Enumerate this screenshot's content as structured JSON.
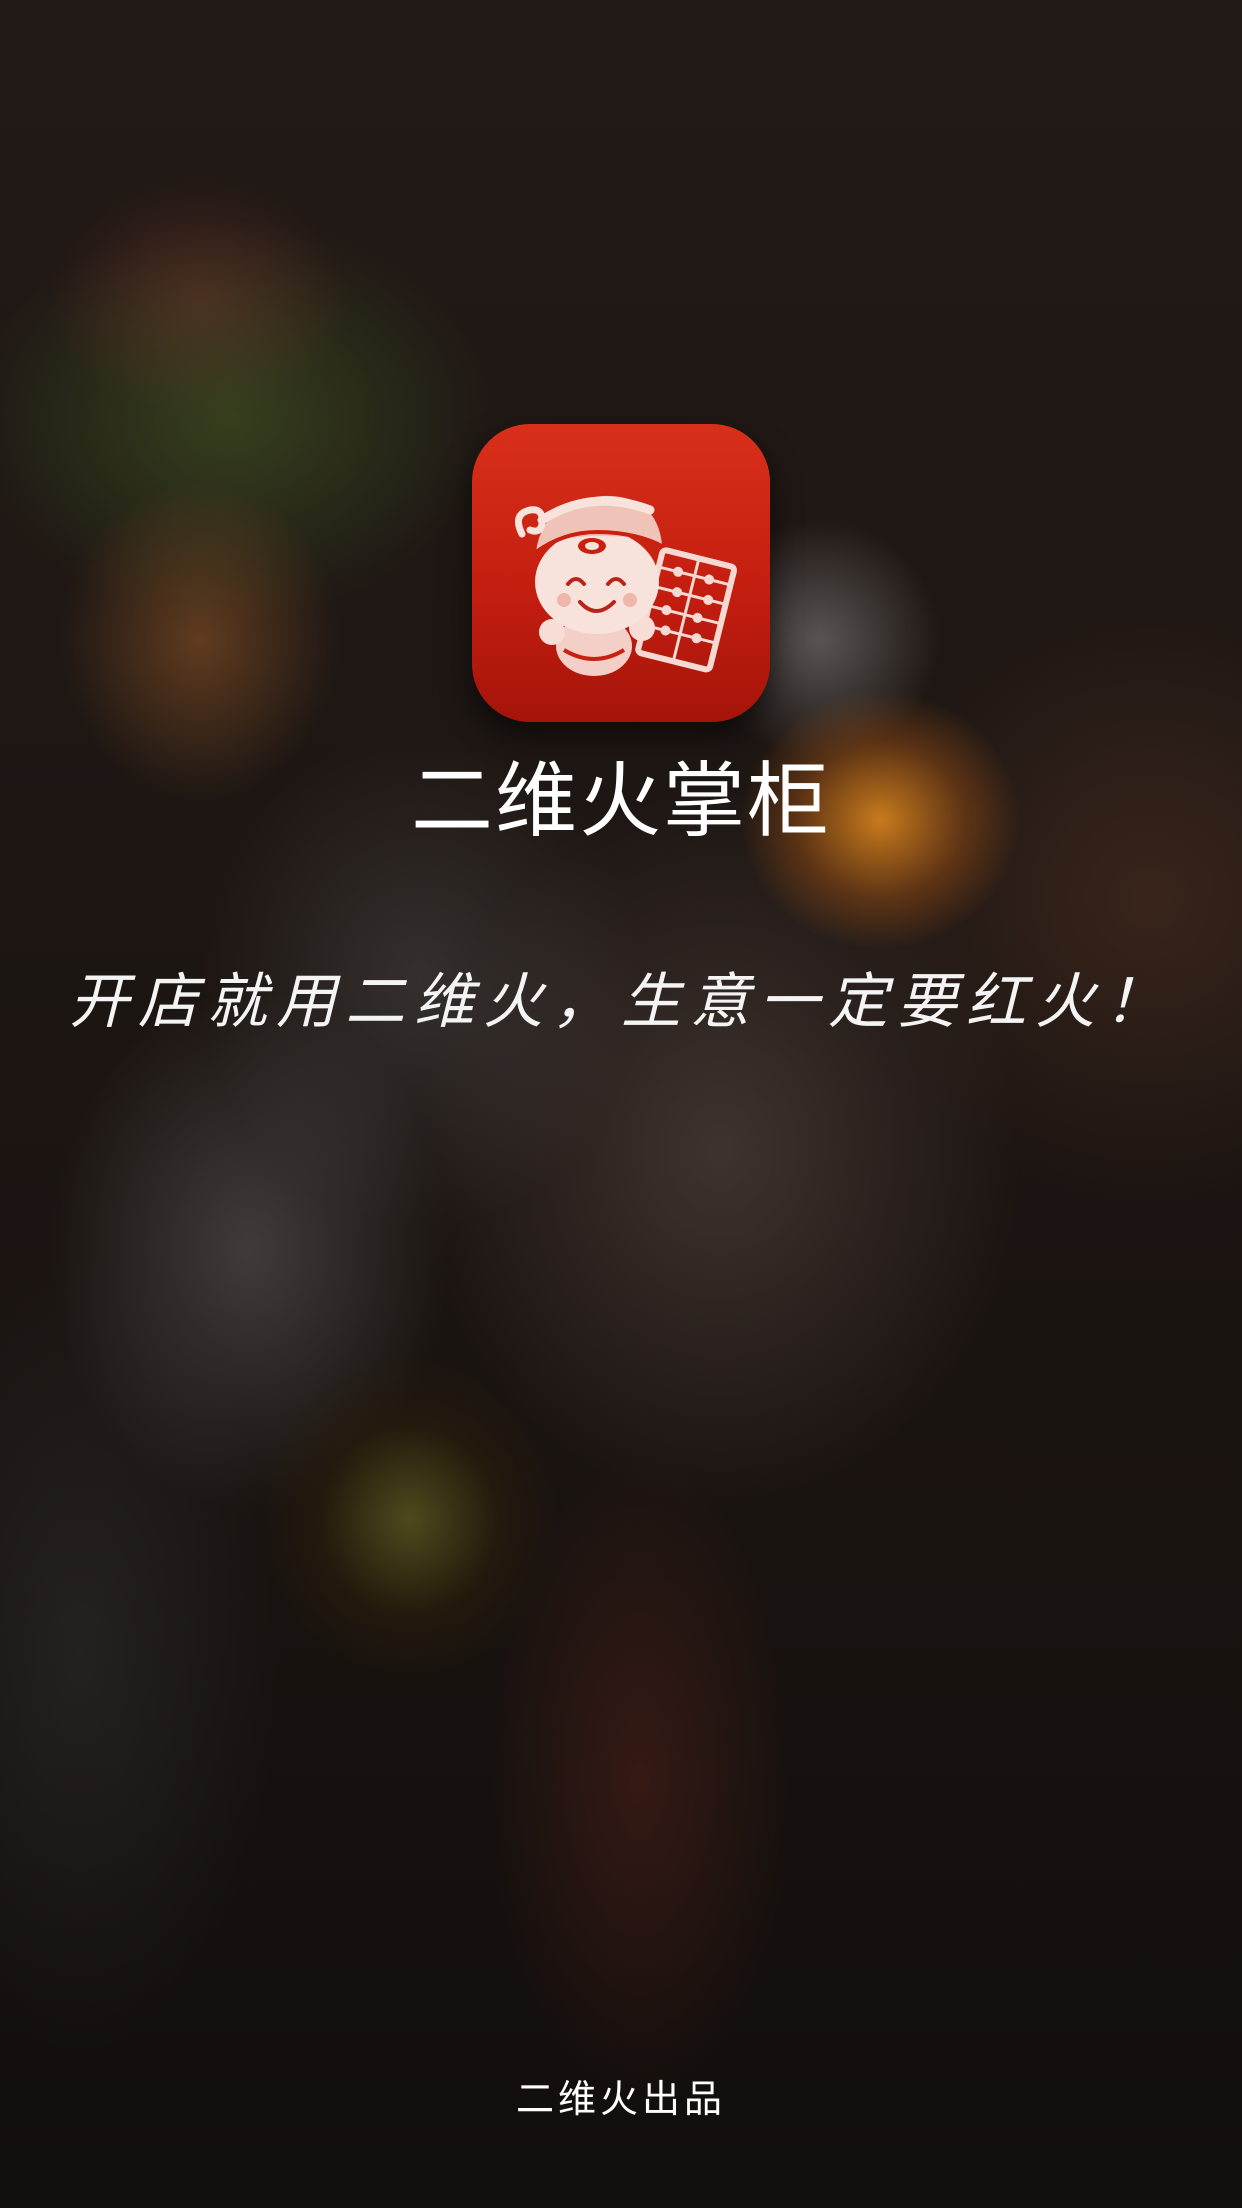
{
  "splash": {
    "app_name": "二维火掌柜",
    "slogan": "开店就用二维火，生意一定要红火！",
    "publisher": "二维火出品",
    "icon": "shopkeeper-mascot-icon",
    "brand_color": "#c9200f"
  }
}
